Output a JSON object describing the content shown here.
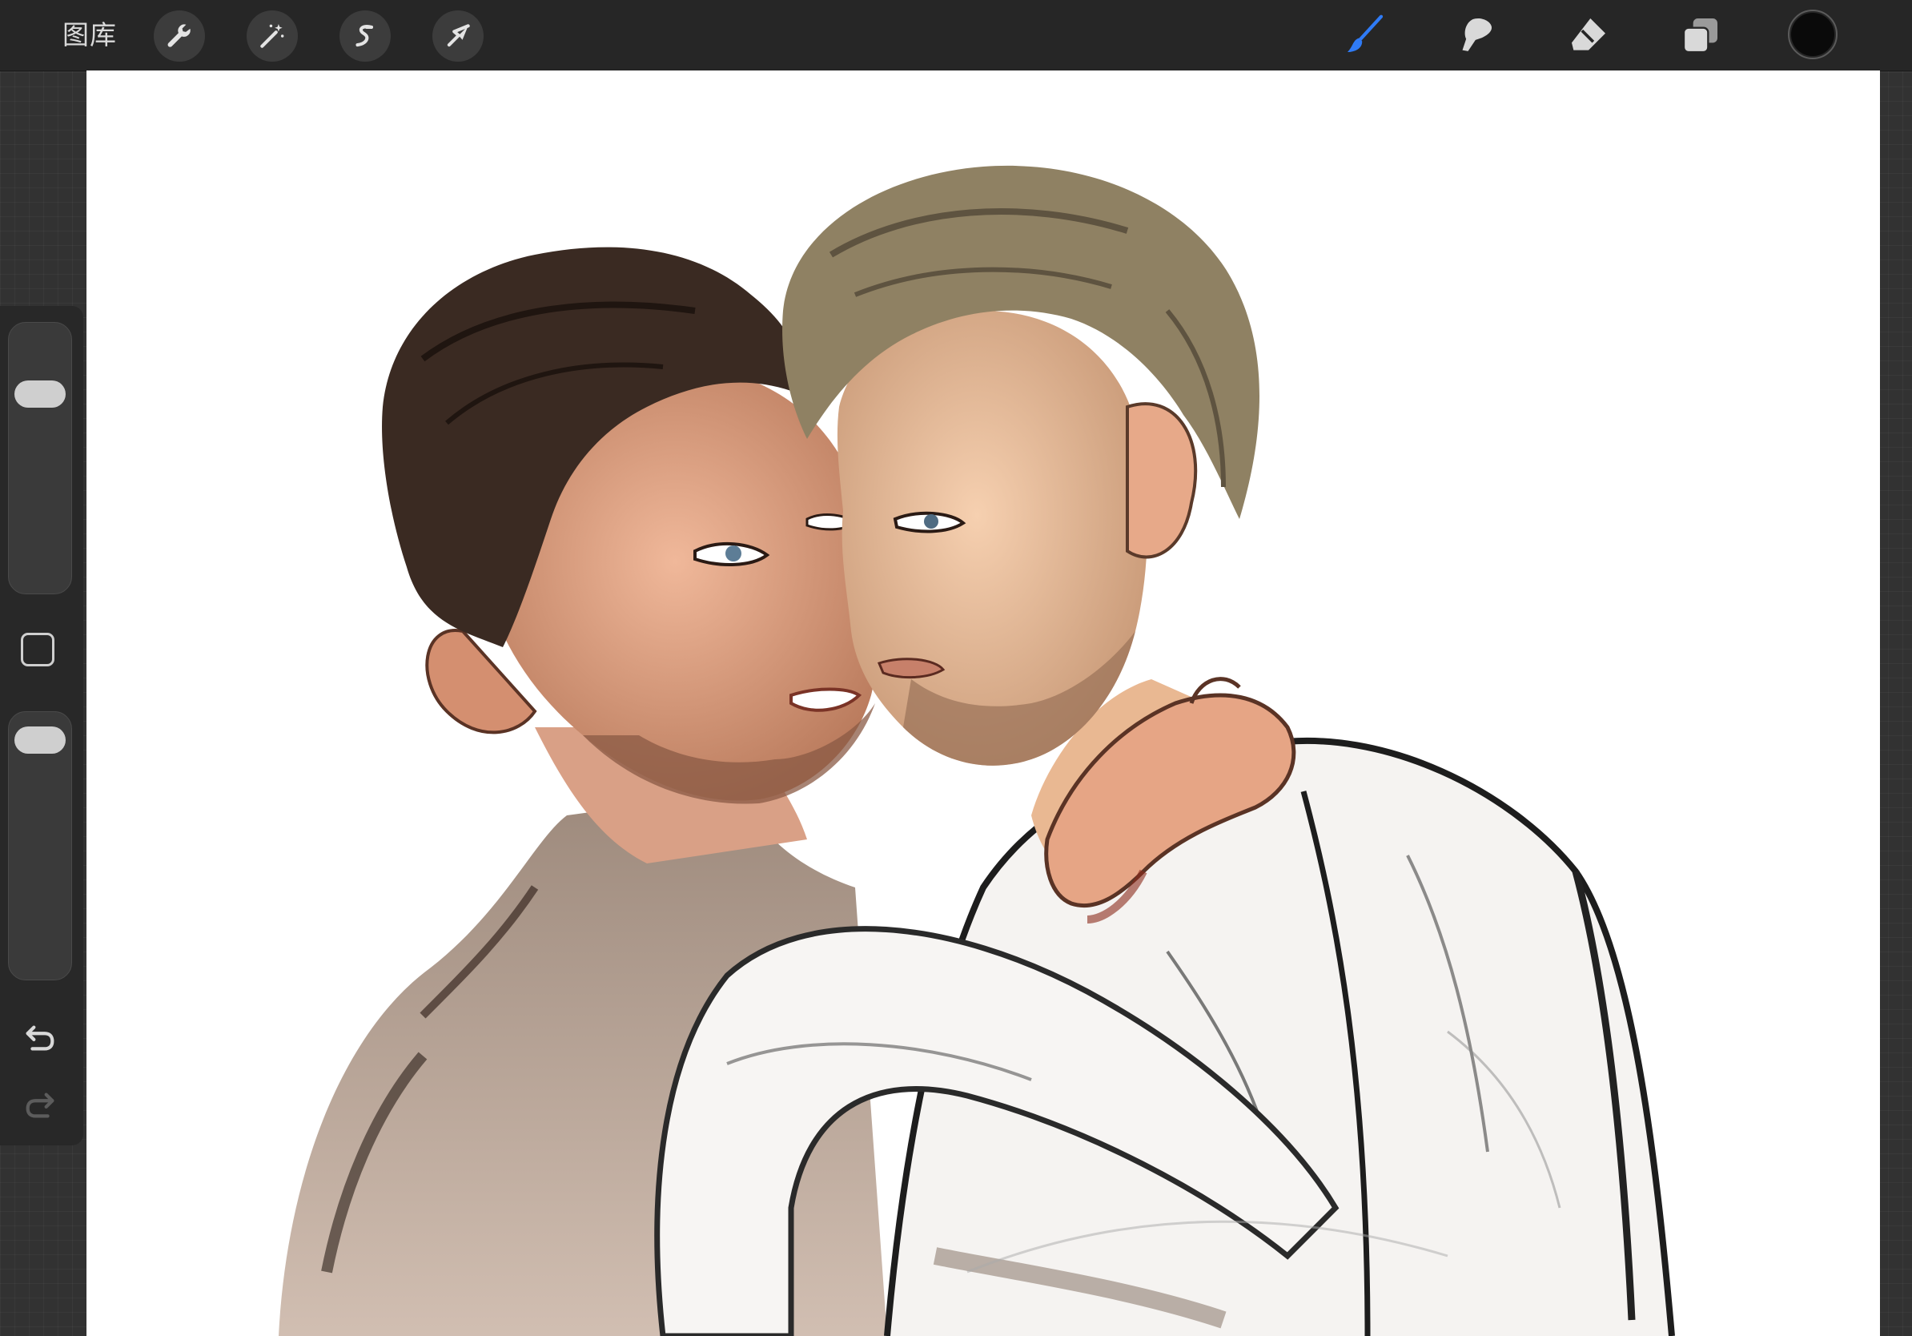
{
  "topbar": {
    "gallery_label": "图库",
    "tools_left": [
      {
        "icon": "wrench-icon",
        "name": "actions"
      },
      {
        "icon": "magic-wand-icon",
        "name": "adjustments"
      },
      {
        "icon": "selection-s-icon",
        "name": "selection"
      },
      {
        "icon": "arrow-cursor-icon",
        "name": "transform"
      }
    ],
    "tools_right": [
      {
        "icon": "brush-icon",
        "name": "paint",
        "active": true
      },
      {
        "icon": "smudge-icon",
        "name": "smudge"
      },
      {
        "icon": "eraser-icon",
        "name": "erase"
      },
      {
        "icon": "layers-icon",
        "name": "layers"
      }
    ],
    "current_color": "#0a0a0a"
  },
  "sidebar": {
    "brush_size_level": 0.78,
    "opacity_level": 0.96,
    "undo_icon": "undo-icon",
    "redo_icon": "redo-icon"
  },
  "canvas": {
    "subject": "illustration-artwork"
  },
  "colors": {
    "accent": "#2f7bf6",
    "toolbar_bg": "#262626",
    "icon": "#d9d9d9"
  }
}
